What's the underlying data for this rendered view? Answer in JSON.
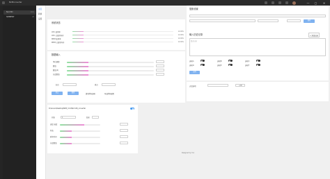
{
  "window": {
    "title": "NCMconverter",
    "controls": [
      "—",
      "▢",
      "✕"
    ]
  },
  "sidebar": {
    "items": [
      {
        "label": "Ncm3D",
        "meta": "1min",
        "active": true
      },
      {
        "label": "SIMBENT",
        "meta": "2d",
        "active": false
      }
    ]
  },
  "nav": {
    "items": [
      {
        "label": "主页",
        "active": true
      },
      {
        "label": "转换",
        "active": false
      },
      {
        "label": "设置",
        "active": false
      }
    ]
  },
  "system_status": {
    "title": "系统状态",
    "rows": [
      {
        "label": "CPU 使用率",
        "value": "10.99%",
        "fill": 0.11
      },
      {
        "label": "CPU 已使用内存",
        "value": "10.99%",
        "fill": 0.11
      },
      {
        "label": "MEM 使用率",
        "value": "10.99%",
        "fill": 0.11
      },
      {
        "label": "MEM 已使用内存",
        "value": "10.99%",
        "fill": 0.11
      }
    ]
  },
  "data_input": {
    "title": "数据输入",
    "section_label": "已输入内容",
    "content_placeholder": "输入内容",
    "items": [
      {
        "label": "单位换算",
        "value": "",
        "fill": 0.25
      },
      {
        "label": "数值",
        "value": "",
        "fill": 0.25
      },
      {
        "label": "数值(2)",
        "value": "",
        "fill": 0.25
      },
      {
        "label": "长度数值",
        "value": "",
        "fill": 0.25
      }
    ],
    "field_a_label": "起点",
    "field_b_label": "终点",
    "submit_label": "提交",
    "reset_label": "重置",
    "clear_label": "清空所有选项",
    "export_label": "导出所有配置"
  },
  "options": {
    "toggles": [
      {
        "label": "选项A",
        "on": false
      },
      {
        "label": "选项B",
        "on": false
      },
      {
        "label": "选项C",
        "on": false
      },
      {
        "label": "选项D",
        "on": false
      },
      {
        "label": "选项E",
        "on": false
      },
      {
        "label": "选项F",
        "on": false
      }
    ],
    "apply_label": "应用"
  },
  "filter": {
    "label": "过滤选项",
    "value": "",
    "filter_button": "过滤"
  },
  "header_card": {
    "title": "搜索设置",
    "search_placeholder": "",
    "secondary_placeholder": "",
    "tertiary_placeholder": "",
    "submit_label": "搜索"
  },
  "history": {
    "title": "输入历史记录",
    "add_label": "+ 添加记录",
    "textarea_placeholder": "暂无记录"
  },
  "path_card": {
    "path": "D:\\lenovo\\Desktop\\NCM_3.0.0\\Ncm3D_converter",
    "toggle_on": true,
    "field_a_label": "开始",
    "field_a_value": "1",
    "field_b_label": "结束",
    "field_b_value": "",
    "rows": [
      {
        "label": "进度 速度",
        "value": "",
        "fill": 0.6
      },
      {
        "label": "状态",
        "value": "",
        "fill": 0.3
      },
      {
        "label": "剩余时间",
        "value": "",
        "fill": 0.3
      },
      {
        "label": "长度数值",
        "value": "",
        "fill": 0.3
      }
    ]
  },
  "footer": {
    "text": "Designed by Yun"
  }
}
